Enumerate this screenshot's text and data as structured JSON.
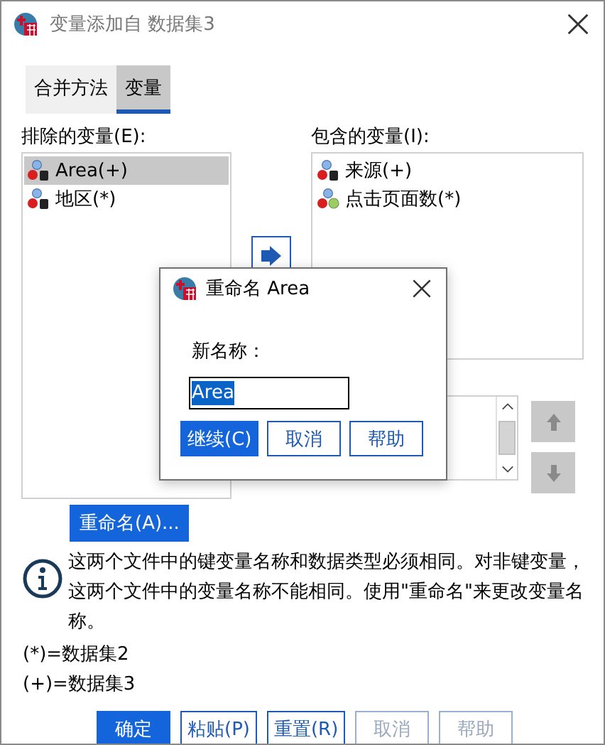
{
  "window": {
    "title": "变量添加自 数据集3"
  },
  "tabs": [
    {
      "label": "合并方法",
      "selected": false
    },
    {
      "label": "变量",
      "selected": true
    }
  ],
  "excluded": {
    "label": "排除的变量(E):",
    "items": [
      {
        "name": "Area(+)",
        "kind": "string",
        "selected": true
      },
      {
        "name": "地区(*)",
        "kind": "string",
        "selected": false
      }
    ]
  },
  "included": {
    "label": "包含的变量(I):",
    "items": [
      {
        "name": "来源(+)",
        "kind": "string",
        "selected": false
      },
      {
        "name": "点击页面数(*)",
        "kind": "numeric",
        "selected": false
      }
    ]
  },
  "move_buttons": [
    {
      "kind": "up",
      "disabled": true
    },
    {
      "kind": "down",
      "disabled": true
    }
  ],
  "rename_button": "重命名(A)...",
  "info": "这两个文件中的键变量名称和数据类型必须相同。对非键变量，这两个文件中的变量名称不能相同。使用\"重命名\"来更改变量名称。",
  "legend": [
    "(*)=数据集2",
    "(+)=数据集3"
  ],
  "buttons": [
    {
      "label": "确定",
      "kind": "primary",
      "disabled": false
    },
    {
      "label": "粘贴(P)",
      "kind": "normal",
      "disabled": false
    },
    {
      "label": "重置(R)",
      "kind": "normal",
      "disabled": false
    },
    {
      "label": "取消",
      "kind": "normal",
      "disabled": true
    },
    {
      "label": "帮助",
      "kind": "normal",
      "disabled": true
    }
  ],
  "rename_dialog": {
    "title": "重命名 Area",
    "field_label": "新名称：",
    "value": "Area",
    "buttons": [
      {
        "label": "继续(C)",
        "kind": "primary",
        "disabled": false
      },
      {
        "label": "取消",
        "kind": "normal",
        "disabled": false
      },
      {
        "label": "帮助",
        "kind": "normal",
        "disabled": false
      }
    ]
  }
}
